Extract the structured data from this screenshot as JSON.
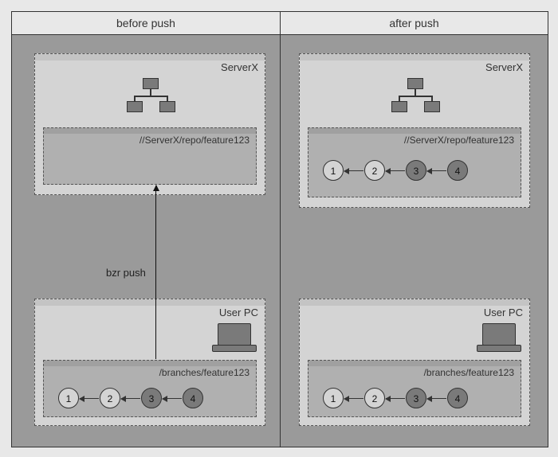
{
  "columns": {
    "left": "before push",
    "right": "after push"
  },
  "locations": {
    "server": "ServerX",
    "client": "User PC"
  },
  "branches": {
    "server": "//ServerX/repo/feature123",
    "client": "/branches/feature123"
  },
  "commits": [
    "1",
    "2",
    "3",
    "4"
  ],
  "shading": {
    "server_before": [],
    "server_after_new": [
      2,
      3
    ],
    "client": [
      2,
      3
    ]
  },
  "command": "bzr push"
}
